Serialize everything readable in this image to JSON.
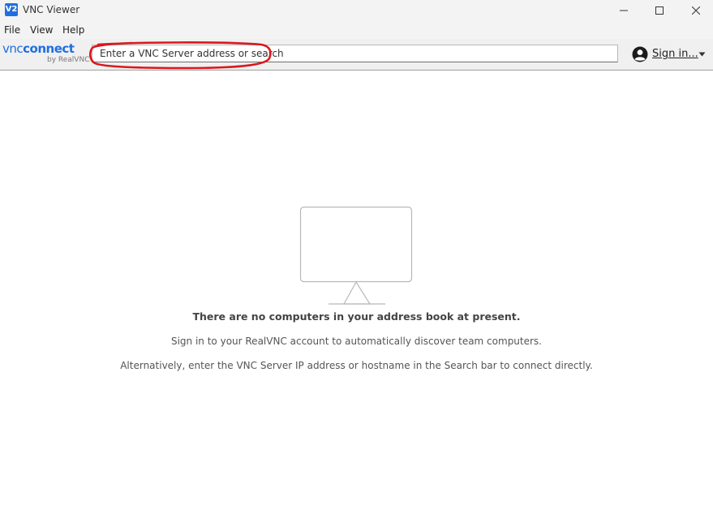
{
  "window": {
    "title": "VNC Viewer",
    "icon_text": "V2"
  },
  "menu": {
    "items": [
      {
        "label": "File"
      },
      {
        "label": "View"
      },
      {
        "label": "Help"
      }
    ]
  },
  "brand": {
    "vnc": "vnc",
    "connect": "connect",
    "by": "by RealVNC",
    "color": "#1f6fe0"
  },
  "search": {
    "placeholder": "Enter a VNC Server address or search",
    "value": ""
  },
  "account": {
    "signin_label": "Sign in..."
  },
  "empty_state": {
    "title": "There are no computers in your address book at present.",
    "line1": "Sign in to your RealVNC account to automatically discover team computers.",
    "line2": "Alternatively, enter the VNC Server IP address or hostname in the Search bar to connect directly."
  },
  "colors": {
    "annotation": "#d9181e",
    "accent": "#1f6fe0",
    "monitor_stroke": "#b8b8b8"
  },
  "icons": {
    "minimize": "minimize-icon",
    "maximize": "maximize-icon",
    "close": "close-icon",
    "avatar": "user-avatar-icon",
    "caret": "caret-down-icon",
    "monitor": "monitor-icon"
  }
}
